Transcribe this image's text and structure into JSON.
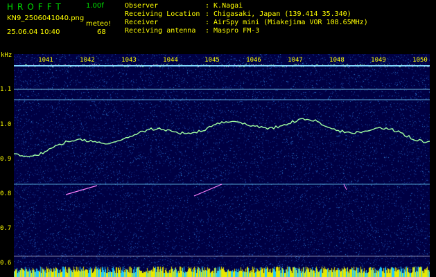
{
  "header": {
    "app_title": "HROFFT",
    "version": "1.00f",
    "file_name": "KN9_2506041040.png",
    "meteor_label": "meteo!",
    "meteor_count": "68",
    "datetime": "25.06.04 10:40",
    "info": [
      {
        "key": "Observer",
        "value": ": K.Nagai"
      },
      {
        "key": "Receiving Location",
        "value": ": Chigasaki, Japan (139.414 35.340)"
      },
      {
        "key": "Receiver",
        "value": ": AirSpy mini (Miakejima VOR 108.65MHz)"
      },
      {
        "key": "Receiving antenna",
        "value": ": Maspro FM-3"
      }
    ]
  },
  "axis": {
    "y_unit": "kHz",
    "y_ticks": [
      "1.1",
      "1.0",
      "0.9",
      "0.8",
      "0.7",
      "0.6"
    ],
    "x_ticks": [
      "1041",
      "1042",
      "1043",
      "1044",
      "1045",
      "1046",
      "1047",
      "1048",
      "1049",
      "1050"
    ]
  },
  "colors": {
    "background": "#000043",
    "label": "#ffff00",
    "title": "#00e000",
    "trace": "#a0ffa0",
    "carrier": "#60d0ff"
  }
}
